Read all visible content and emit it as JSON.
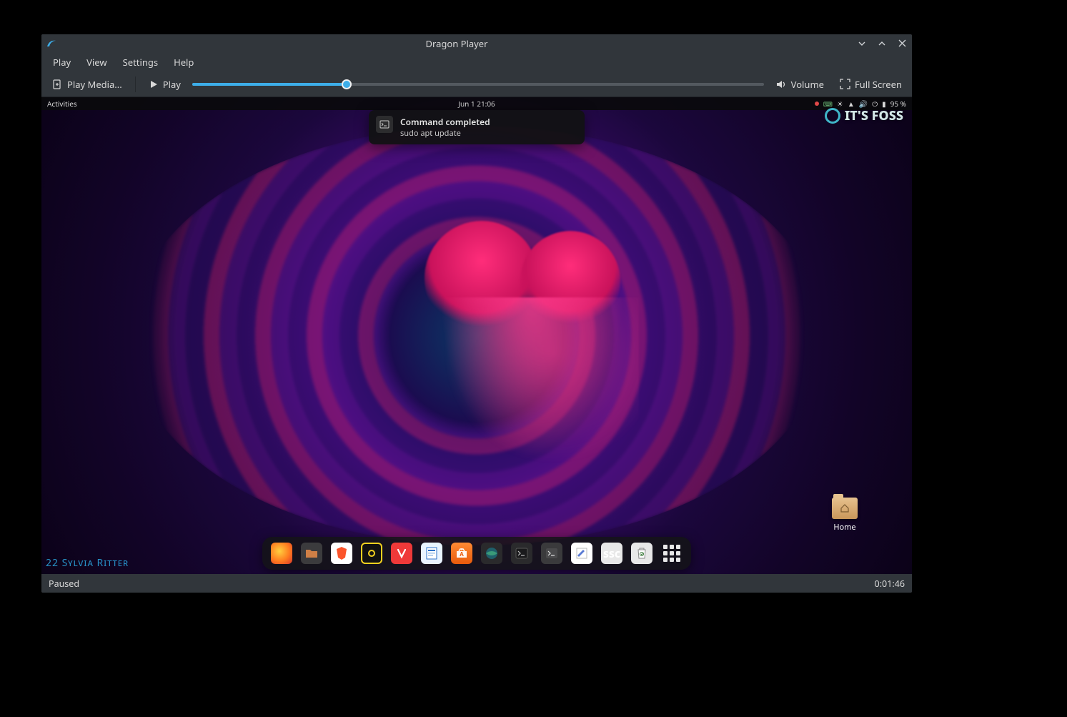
{
  "window": {
    "title": "Dragon Player",
    "minimize_tooltip": "Minimize",
    "maximize_tooltip": "Maximize",
    "close_tooltip": "Close"
  },
  "menu": {
    "play": "Play",
    "view": "View",
    "settings": "Settings",
    "help": "Help"
  },
  "toolbar": {
    "play_media": "Play Media...",
    "play": "Play",
    "volume": "Volume",
    "full_screen": "Full Screen",
    "seek_percent": 27
  },
  "status": {
    "state": "Paused",
    "time": "0:01:46"
  },
  "video_desktop": {
    "topbar": {
      "activities": "Activities",
      "clock": "Jun 1  21:06",
      "battery": "95 %"
    },
    "notification": {
      "title": "Command completed",
      "body": "sudo apt update"
    },
    "watermark": "IT'S FOSS",
    "artist_credit": "22 Sylvia Ritter",
    "home_label": "Home",
    "dock": [
      {
        "name": "firefox",
        "tip": "Firefox"
      },
      {
        "name": "files",
        "tip": "Files"
      },
      {
        "name": "brave",
        "tip": "Brave"
      },
      {
        "name": "jdownloader",
        "tip": "JDownloader"
      },
      {
        "name": "vivaldi",
        "tip": "Vivaldi"
      },
      {
        "name": "writer",
        "tip": "LibreOffice Writer"
      },
      {
        "name": "software",
        "tip": "Ubuntu Software"
      },
      {
        "name": "globe",
        "tip": "Web Browser"
      },
      {
        "name": "terminal-dark",
        "tip": "Terminal"
      },
      {
        "name": "terminal-light",
        "tip": "Terminal"
      },
      {
        "name": "text-editor",
        "tip": "Text Editor"
      },
      {
        "name": "ssc",
        "tip": "SSC"
      },
      {
        "name": "trash",
        "tip": "Trash"
      },
      {
        "name": "show-apps",
        "tip": "Show Applications"
      }
    ]
  }
}
